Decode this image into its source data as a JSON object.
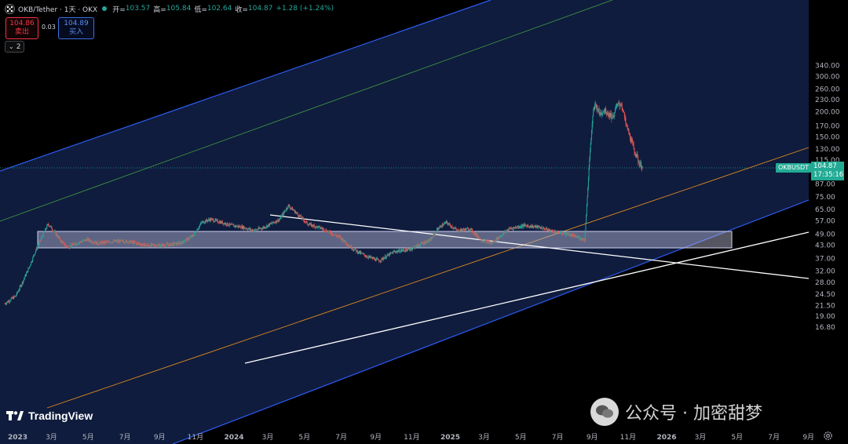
{
  "header": {
    "symbol": "OKB/Tether · 1天 · OKX",
    "open_label": "开=",
    "open_value": "103.57",
    "high_label": "高=",
    "high_value": "105.84",
    "low_label": "低=",
    "low_value": "102.64",
    "close_label": "收=",
    "close_value": "104.87",
    "change": "+1.28 (+1.24%)"
  },
  "trade": {
    "sell_price": "104.86",
    "sell_label": "卖出",
    "spread": "0.03",
    "buy_price": "104.89",
    "buy_label": "买入"
  },
  "indicators_toggle": "2",
  "last_price": {
    "symbol_tag": "OKBUSDT",
    "price": "104.87",
    "countdown": "17:35:16"
  },
  "branding": {
    "tradingview": "TradingView",
    "watermark": "公众号 · 加密甜梦"
  },
  "colors": {
    "up": "#26a69a",
    "down": "#ef5350",
    "channel": "#2962ff",
    "channel_fill": "#0d1a3a",
    "midline_green": "#4caf50",
    "midline_orange": "#ff9800",
    "trendline": "#ffffff",
    "resistance_zone": "#9e9ec8"
  },
  "chart_data": {
    "type": "candlestick",
    "series": [
      {
        "name": "OKBUSDT",
        "values": [
          [
            2022.95,
            22
          ],
          [
            2023.0,
            24
          ],
          [
            2023.03,
            28
          ],
          [
            2023.06,
            33
          ],
          [
            2023.09,
            40
          ],
          [
            2023.12,
            47
          ],
          [
            2023.15,
            55
          ],
          [
            2023.18,
            50
          ],
          [
            2023.21,
            45
          ],
          [
            2023.24,
            42
          ],
          [
            2023.28,
            44
          ],
          [
            2023.33,
            46
          ],
          [
            2023.38,
            44
          ],
          [
            2023.45,
            45
          ],
          [
            2023.52,
            45
          ],
          [
            2023.6,
            43
          ],
          [
            2023.68,
            43
          ],
          [
            2023.76,
            44
          ],
          [
            2023.82,
            48
          ],
          [
            2023.86,
            56
          ],
          [
            2023.9,
            58
          ],
          [
            2023.95,
            56
          ],
          [
            2024.0,
            54
          ],
          [
            2024.05,
            53
          ],
          [
            2024.1,
            51
          ],
          [
            2024.15,
            53
          ],
          [
            2024.22,
            58
          ],
          [
            2024.26,
            68
          ],
          [
            2024.3,
            62
          ],
          [
            2024.35,
            55
          ],
          [
            2024.42,
            52
          ],
          [
            2024.5,
            47
          ],
          [
            2024.55,
            42
          ],
          [
            2024.58,
            40
          ],
          [
            2024.62,
            38
          ],
          [
            2024.68,
            36
          ],
          [
            2024.75,
            40
          ],
          [
            2024.82,
            41
          ],
          [
            2024.88,
            44
          ],
          [
            2024.92,
            46
          ],
          [
            2024.95,
            52
          ],
          [
            2024.99,
            56
          ],
          [
            2025.04,
            51
          ],
          [
            2025.1,
            52
          ],
          [
            2025.15,
            46
          ],
          [
            2025.2,
            44
          ],
          [
            2025.28,
            52
          ],
          [
            2025.35,
            54
          ],
          [
            2025.42,
            53
          ],
          [
            2025.5,
            50
          ],
          [
            2025.55,
            49
          ],
          [
            2025.6,
            47
          ],
          [
            2025.63,
            46
          ],
          [
            2025.64,
            68
          ],
          [
            2025.65,
            105
          ],
          [
            2025.66,
            150
          ],
          [
            2025.67,
            200
          ],
          [
            2025.68,
            218
          ],
          [
            2025.7,
            195
          ],
          [
            2025.72,
            205
          ],
          [
            2025.76,
            188
          ],
          [
            2025.78,
            215
          ],
          [
            2025.8,
            220
          ],
          [
            2025.82,
            175
          ],
          [
            2025.84,
            150
          ],
          [
            2025.86,
            128
          ],
          [
            2025.88,
            112
          ],
          [
            2025.9,
            104.87
          ]
        ]
      }
    ],
    "y_scale": "log",
    "y_axis_ticks": [
      "340.00",
      "300.00",
      "260.00",
      "230.00",
      "200.00",
      "170.00",
      "150.00",
      "130.00",
      "115.00",
      "104.87",
      "87.00",
      "75.00",
      "65.00",
      "57.00",
      "49.00",
      "43.00",
      "37.00",
      "32.00",
      "28.00",
      "24.50",
      "21.50",
      "19.00",
      "16.80"
    ],
    "x_axis_ticks": [
      "2023",
      "3月",
      "5月",
      "7月",
      "9月",
      "11月",
      "2024",
      "3月",
      "5月",
      "7月",
      "9月",
      "11月",
      "2025",
      "3月",
      "5月",
      "7月",
      "9月",
      "11月",
      "2026",
      "3月",
      "5月",
      "7月",
      "9月"
    ],
    "annotations": [
      "ascending channel",
      "descending trendline",
      "ascending trendline",
      "resistance zone 58-65"
    ],
    "grid": false,
    "legend": "none"
  }
}
